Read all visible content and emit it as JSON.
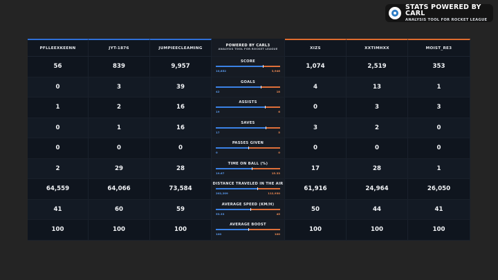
{
  "brand": {
    "title": "STATS POWERED BY CARL",
    "subtitle": "ANALYSIS TOOL FOR ROCKET LEAGUE",
    "icon": "carl-logo-icon"
  },
  "center_header": {
    "title": "POWERED BY CARL3",
    "subtitle": "ANALYSIS TOOL FOR ROCKET LEAGUE"
  },
  "colors": {
    "blue": "#3b82e6",
    "orange": "#e0703a"
  },
  "players_blue": [
    "PFLLEEXKEENN",
    "JYT-1876",
    "JUMPIEECLEAMING"
  ],
  "players_orange": [
    "XIZS",
    "XXTIMHXX",
    "MOIST_RE3"
  ],
  "stats": [
    {
      "label": "SCORE",
      "blue": [
        "56",
        "839",
        "9,957"
      ],
      "orange": [
        "1,074",
        "2,519",
        "353"
      ],
      "team_blue": "10,852",
      "team_orange": "3,946",
      "blue_share": 0.733
    },
    {
      "label": "GOALS",
      "blue": [
        "0",
        "3",
        "39"
      ],
      "orange": [
        "4",
        "13",
        "1"
      ],
      "team_blue": "42",
      "team_orange": "18",
      "blue_share": 0.7
    },
    {
      "label": "ASSISTS",
      "blue": [
        "1",
        "2",
        "16"
      ],
      "orange": [
        "0",
        "3",
        "3"
      ],
      "team_blue": "19",
      "team_orange": "6",
      "blue_share": 0.76
    },
    {
      "label": "SAVES",
      "blue": [
        "0",
        "1",
        "16"
      ],
      "orange": [
        "3",
        "2",
        "0"
      ],
      "team_blue": "17",
      "team_orange": "5",
      "blue_share": 0.77
    },
    {
      "label": "PASSES GIVEN",
      "blue": [
        "0",
        "0",
        "0"
      ],
      "orange": [
        "0",
        "0",
        "0"
      ],
      "team_blue": "0",
      "team_orange": "0",
      "blue_share": 0.5
    },
    {
      "label": "TIME ON BALL (%)",
      "blue": [
        "2",
        "29",
        "28"
      ],
      "orange": [
        "17",
        "28",
        "1"
      ],
      "team_blue": "19.67",
      "team_orange": "15.33",
      "blue_share": 0.56
    },
    {
      "label": "DISTANCE TRAVELED IN THE AIR",
      "blue": [
        "64,559",
        "64,066",
        "73,584"
      ],
      "orange": [
        "61,916",
        "24,964",
        "26,050"
      ],
      "team_blue": "202,209",
      "team_orange": "112,930",
      "blue_share": 0.64
    },
    {
      "label": "AVERAGE SPEED (KM/H)",
      "blue": [
        "41",
        "60",
        "59"
      ],
      "orange": [
        "50",
        "44",
        "41"
      ],
      "team_blue": "53.33",
      "team_orange": "45",
      "blue_share": 0.54
    },
    {
      "label": "AVERAGE BOOST",
      "blue": [
        "100",
        "100",
        "100"
      ],
      "orange": [
        "100",
        "100",
        "100"
      ],
      "team_blue": "100",
      "team_orange": "100",
      "blue_share": 0.5
    }
  ]
}
